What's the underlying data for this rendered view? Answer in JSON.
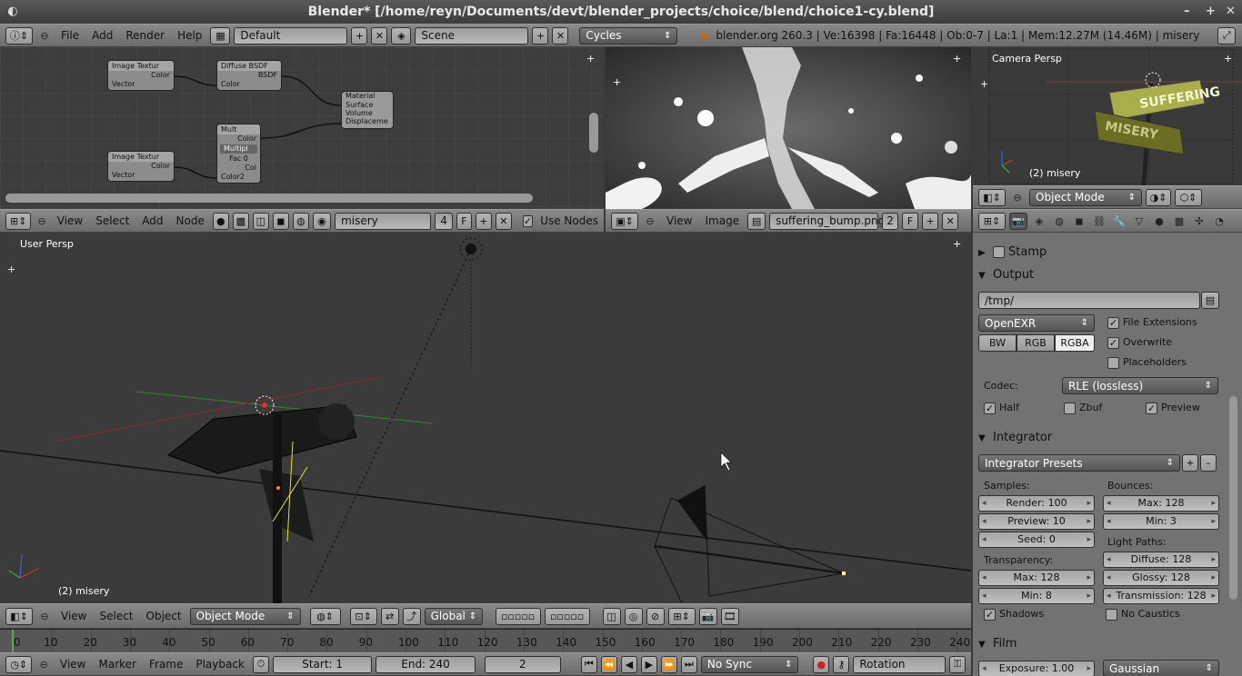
{
  "window": {
    "title": "Blender* [/home/reyn/Documents/devt/blender_projects/choice/blend/choice1-cy.blend]"
  },
  "top_header": {
    "menus": [
      "File",
      "Add",
      "Render",
      "Help"
    ],
    "layout": "Default",
    "scene": "Scene",
    "engine": "Cycles",
    "stats": "blender.org 260.3 | Ve:16398 | Fa:16448 | Ob:0-7 | La:1 | Mem:12.27M (14.46M) | misery"
  },
  "node_editor": {
    "nodes": {
      "img1_title": "Image Textur",
      "img1_color": "Color",
      "img1_vector": "Vector",
      "diffuse_title": "Diffuse BSDF",
      "diffuse_bsdf": "BSDF",
      "diffuse_color": "Color",
      "material_title": "Material",
      "mat_surface": "Surface",
      "mat_volume": "Volume",
      "mat_disp": "Displaceme",
      "mult_title": "Mult",
      "mult_color": "Color",
      "mult_op": "Multipl",
      "mult_fac": "Fac 0",
      "mult_col": "Col",
      "mult_color2": "Color2",
      "img2_title": "Image Textur",
      "img2_color": "Color",
      "img2_vector": "Vector"
    },
    "header": {
      "menus": [
        "View",
        "Select",
        "Add",
        "Node"
      ],
      "material": "misery",
      "users": "4",
      "fake": "F",
      "use_nodes": "Use Nodes"
    }
  },
  "image_editor": {
    "header": {
      "menus": [
        "View",
        "Image"
      ],
      "image": "suffering_bump.png",
      "users": "2",
      "fake": "F"
    }
  },
  "camera_view": {
    "label": "Camera Persp",
    "object": "(2) misery",
    "sign1": "SUFFERING",
    "sign2": "MISERY",
    "mode": "Object Mode"
  },
  "viewport": {
    "label": "User Persp",
    "object": "(2) misery"
  },
  "viewport_header": {
    "menus": [
      "View",
      "Select",
      "Object"
    ],
    "mode": "Object Mode",
    "orientation": "Global"
  },
  "timeline": {
    "ticks": [
      "0",
      "10",
      "20",
      "30",
      "40",
      "50",
      "60",
      "70",
      "80",
      "90",
      "100",
      "110",
      "120",
      "130",
      "140",
      "150",
      "160",
      "170",
      "180",
      "190",
      "200",
      "210",
      "220",
      "230",
      "240"
    ]
  },
  "timeline_header": {
    "menus": [
      "View",
      "Marker",
      "Frame",
      "Playback"
    ],
    "start": "Start: 1",
    "end": "End: 240",
    "current": "2",
    "sync": "No Sync",
    "keying": "Rotation"
  },
  "properties": {
    "stamp": "Stamp",
    "output": {
      "title": "Output",
      "path": "/tmp/",
      "format": "OpenEXR",
      "file_ext": "File Extensions",
      "overwrite": "Overwrite",
      "placeholders": "Placeholders",
      "bw": "BW",
      "rgb": "RGB",
      "rgba": "RGBA",
      "codec_label": "Codec:",
      "codec": "RLE (lossless)",
      "half": "Half",
      "zbuf": "Zbuf",
      "preview": "Preview"
    },
    "integrator": {
      "title": "Integrator",
      "presets": "Integrator Presets",
      "samples_label": "Samples:",
      "render": "Render: 100",
      "preview": "Preview: 10",
      "seed": "Seed: 0",
      "bounces_label": "Bounces:",
      "max": "Max: 128",
      "min": "Min: 3",
      "transparency_label": "Transparency:",
      "t_max": "Max: 128",
      "t_min": "Min: 8",
      "light_paths_label": "Light Paths:",
      "diffuse": "Diffuse: 128",
      "glossy": "Glossy: 128",
      "transmission": "Transmission: 128",
      "shadows": "Shadows",
      "no_caustics": "No Caustics"
    },
    "film": {
      "title": "Film",
      "exposure": "Exposure: 1.00",
      "filter": "Gaussian"
    }
  }
}
